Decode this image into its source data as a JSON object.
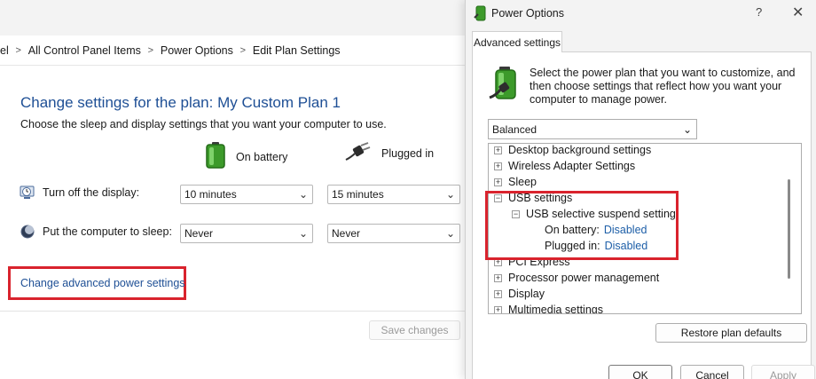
{
  "control_panel": {
    "breadcrumb": [
      "el",
      "All Control Panel Items",
      "Power Options",
      "Edit Plan Settings"
    ],
    "heading": "Change settings for the plan: My Custom Plan 1",
    "subheading": "Choose the sleep and display settings that you want your computer to use.",
    "columns": {
      "battery": "On battery",
      "plugged": "Plugged in"
    },
    "rows": {
      "display": {
        "label": "Turn off the display:",
        "battery": "10 minutes",
        "plugged": "15 minutes"
      },
      "sleep": {
        "label": "Put the computer to sleep:",
        "battery": "Never",
        "plugged": "Never"
      }
    },
    "advanced_link": "Change advanced power settings",
    "save_button": "Save changes"
  },
  "dialog": {
    "title": "Power Options",
    "help": "?",
    "close": "✕",
    "tab": "Advanced settings",
    "description": "Select the power plan that you want to customize, and then choose settings that reflect how you want your computer to manage power.",
    "plan_selected": "Balanced",
    "tree": [
      {
        "label": "Desktop background settings",
        "expander": "+"
      },
      {
        "label": "Wireless Adapter Settings",
        "expander": "+"
      },
      {
        "label": "Sleep",
        "expander": "+"
      },
      {
        "label": "USB settings",
        "expander": "−"
      },
      {
        "label": "USB selective suspend setting",
        "expander": "−"
      },
      {
        "label": "On battery:",
        "value": "Disabled"
      },
      {
        "label": "Plugged in:",
        "value": "Disabled"
      },
      {
        "label": "PCI Express",
        "expander": "+"
      },
      {
        "label": "Processor power management",
        "expander": "+"
      },
      {
        "label": "Display",
        "expander": "+"
      },
      {
        "label": "Multimedia settings",
        "expander": "+"
      }
    ],
    "restore_button": "Restore plan defaults",
    "ok_button": "OK",
    "cancel_button": "Cancel",
    "apply_button": "Apply"
  },
  "icons": {
    "battery": "battery-icon",
    "plug": "plug-icon",
    "display": "clock-monitor-icon",
    "sleep": "moon-icon",
    "power_plan": "power-plan-icon"
  },
  "colors": {
    "link": "#1e4f95",
    "highlight": "#d9232d",
    "value": "#1e5fa8"
  }
}
